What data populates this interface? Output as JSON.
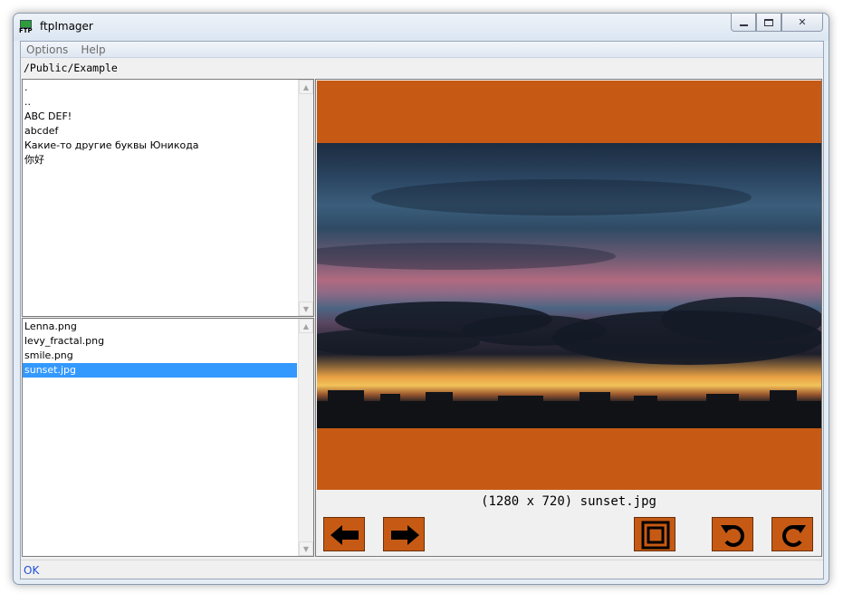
{
  "window": {
    "title": "ftpImager",
    "icon_name": "ftp-app-icon",
    "icon_text": "FTP"
  },
  "menu": {
    "items": [
      "Options",
      "Help"
    ]
  },
  "path": "/Public/Example",
  "directories": [
    ".",
    "..",
    "ABC DEF!",
    "abcdef",
    "Какие-то другие буквы Юникода",
    "你好"
  ],
  "files": [
    {
      "name": "Lenna.png",
      "selected": false
    },
    {
      "name": "levy_fractal.png",
      "selected": false
    },
    {
      "name": "smile.png",
      "selected": false
    },
    {
      "name": "sunset.jpg",
      "selected": true
    }
  ],
  "viewer": {
    "caption": "(1280 x 720) sunset.jpg",
    "background_color": "#c65a14",
    "buttons": [
      "previous-image",
      "next-image",
      "fit-to-window",
      "rotate-left",
      "rotate-right"
    ]
  },
  "status": {
    "text": "OK",
    "color": "#1f4fd9"
  },
  "colors": {
    "selection": "#3399ff",
    "button_accent": "#c65a14"
  }
}
